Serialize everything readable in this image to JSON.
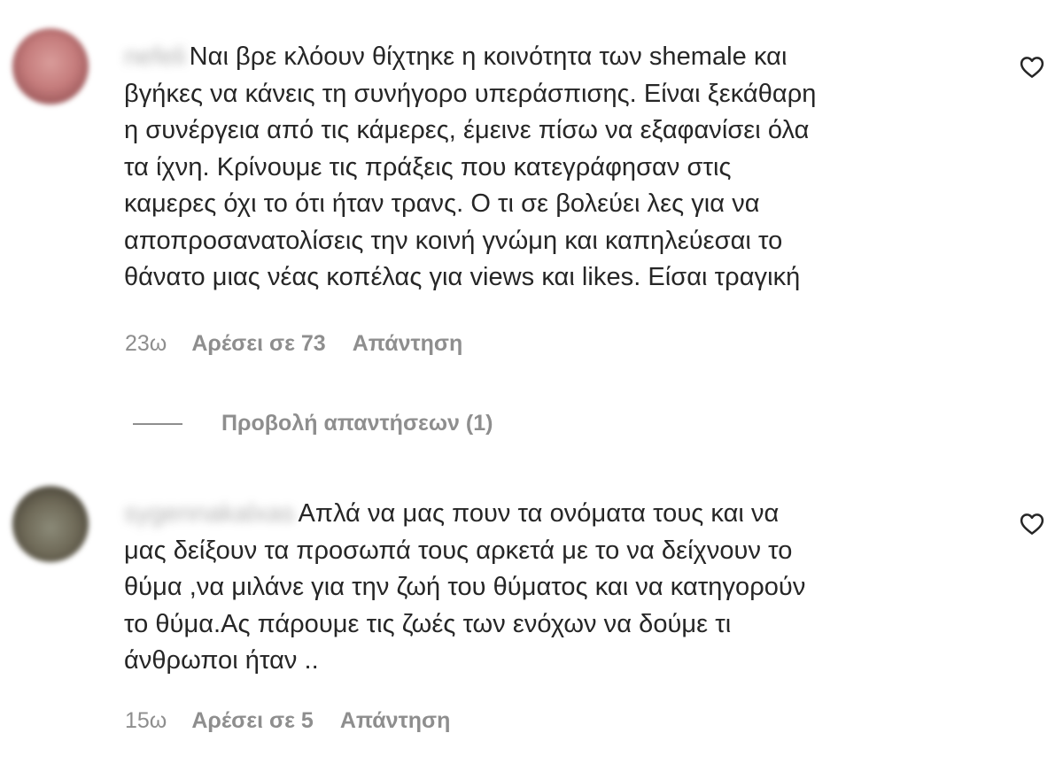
{
  "comments": [
    {
      "username": "nefeli",
      "lines": [
        "Ναι βρε κλόουν θίχτηκε η κοινότητα των shemale και",
        "βγήκες να κάνεις τη συνήγορο υπεράσπισης. Είναι ξεκάθαρη",
        "η συνέργεια από τις κάμερες, έμεινε πίσω να εξαφανίσει όλα",
        "τα ίχνη. Κρίνουμε τις πράξεις που κατεγράφησαν στις",
        "καμερες όχι το ότι ήταν τρανς. Ο τι σε βολεύει λες για να",
        "αποπροσανατολίσεις την κοινή γνώμη και καπηλεύεσαι το",
        "θάνατο μιας νέας κοπέλας για views και likes. Είσαι τραγική"
      ],
      "time": "23ω",
      "likes": "Αρέσει σε 73",
      "reply": "Απάντηση",
      "view_replies": "Προβολή απαντήσεων (1)"
    },
    {
      "username": "sygennakalxas",
      "lines": [
        "Απλά να μας πουν τα ονόματα τους και να",
        "μας δείξουν τα προσωπά τους αρκετά με το να δείχνουν το",
        "θύμα ,να μιλάνε για την ζωή του θύματος και να κατηγορούν",
        "το θύμα.Ας πάρουμε τις ζωές των ενόχων να δούμε τι",
        "άνθρωποι ήταν .."
      ],
      "time": "15ω",
      "likes": "Αρέσει σε 5",
      "reply": "Απάντηση"
    }
  ],
  "icons": {
    "like": "heart-outline-icon"
  },
  "colors": {
    "text": "#262626",
    "secondary": "#8e8e8e"
  }
}
